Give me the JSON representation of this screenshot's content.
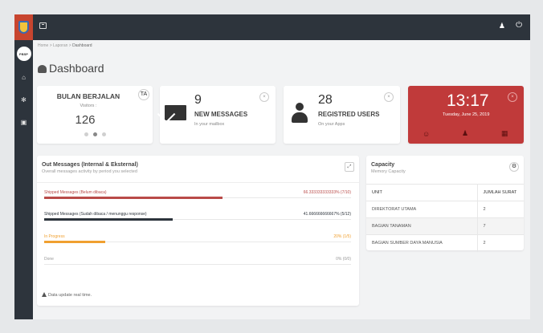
{
  "sidebar": {
    "app_badge": "PBSP",
    "nav": [
      {
        "icon": "home-icon",
        "glyph": "⌂"
      },
      {
        "icon": "settings-icon",
        "glyph": "✻"
      },
      {
        "icon": "document-icon",
        "glyph": "▣"
      }
    ]
  },
  "topbar": {
    "bell_glyph": "♟",
    "power_glyph": "⏻"
  },
  "breadcrumb": {
    "home": "Home",
    "sep": ">",
    "laporan": "Laporan",
    "current": "Dashboard"
  },
  "page_title": "Dashboard",
  "cards": {
    "bulan": {
      "title": "BULAN BERJALAN",
      "subtitle": "Visitors :",
      "value": "126",
      "badge": "TA"
    },
    "messages": {
      "count": "9",
      "label": "NEW MESSAGES",
      "sub": "In your mailbox",
      "close_glyph": "×"
    },
    "users": {
      "count": "28",
      "label": "REGISTRED USERS",
      "sub": "On your Apps",
      "close_glyph": "×"
    },
    "clock": {
      "time": "13:17",
      "date": "Tuesday, June 25, 2019",
      "close_glyph": "×",
      "icons": [
        "☺",
        "♟",
        "▦"
      ]
    }
  },
  "out_messages": {
    "title": "Out Messages (Internal & Eksternal)",
    "subtitle": "Overall messages activity by period you selected",
    "expand_glyph": "⤢",
    "rows": [
      {
        "label": "Shipped Messages (Belum dibaca)",
        "value": "66.333333333333% (7/10)",
        "progress": 0.58,
        "color": "#b94a48"
      },
      {
        "label": "Shipped Messages (Sudah dibaca / menunggu response)",
        "value": "41.666666666667% (5/12)",
        "progress": 0.42,
        "color": "#2d343c"
      },
      {
        "label": "In Progress",
        "value": "20% (1/5)",
        "progress": 0.2,
        "color": "#f0a030"
      },
      {
        "label": "Done",
        "value": "0% (0/0)",
        "progress": 0,
        "color": "#999999"
      }
    ],
    "footer": "Data update real time."
  },
  "capacity": {
    "title": "Capacity",
    "subtitle": "Memory Capacity",
    "gear_glyph": "⚙",
    "columns": [
      "UNIT",
      "JUMLAH SURAT"
    ],
    "rows": [
      [
        "DIREKTORAT UTAMA",
        "2"
      ],
      [
        "BAGIAN TANAMAN",
        "7"
      ],
      [
        "BAGIAN SUMBER DAYA MANUSIA",
        "2"
      ]
    ]
  },
  "colors": {
    "sidebar_bg": "#2d343c",
    "accent_red": "#c03a3a",
    "logo_red": "#c8452f"
  }
}
